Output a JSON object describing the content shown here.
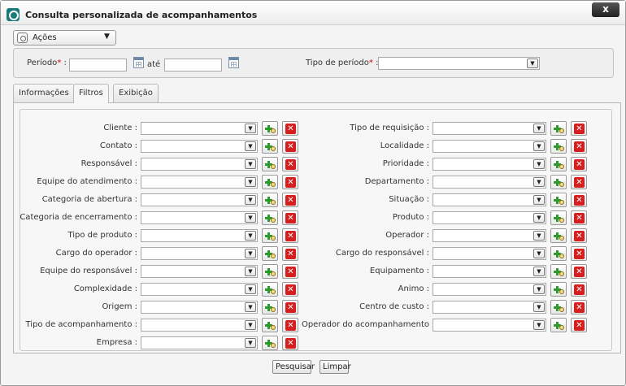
{
  "window": {
    "title": "Consulta personalizada de acompanhamentos",
    "close_label": "x"
  },
  "actions_menu": {
    "label": "Ações",
    "arrow": "▼"
  },
  "period": {
    "label": "Período",
    "required_mark": "*",
    "colon": ":",
    "start_value": "",
    "between_label": "até",
    "end_value": "",
    "type_label": "Tipo de período",
    "type_value": ""
  },
  "tabs": [
    {
      "label": "Informações"
    },
    {
      "label": "Filtros"
    },
    {
      "label": "Exibição"
    }
  ],
  "active_tab": "Filtros",
  "filters": {
    "left": [
      {
        "label": "Cliente :",
        "value": ""
      },
      {
        "label": "Contato :",
        "value": ""
      },
      {
        "label": "Responsável :",
        "value": ""
      },
      {
        "label": "Equipe do atendimento :",
        "value": ""
      },
      {
        "label": "Categoria de abertura :",
        "value": ""
      },
      {
        "label": "Categoria de encerramento :",
        "value": ""
      },
      {
        "label": "Tipo de produto :",
        "value": ""
      },
      {
        "label": "Cargo do operador :",
        "value": ""
      },
      {
        "label": "Equipe do responsável :",
        "value": ""
      },
      {
        "label": "Complexidade :",
        "value": ""
      },
      {
        "label": "Origem :",
        "value": ""
      },
      {
        "label": "Tipo de acompanhamento :",
        "value": ""
      },
      {
        "label": "Empresa :",
        "value": ""
      }
    ],
    "right": [
      {
        "label": "Tipo de requisição :",
        "value": ""
      },
      {
        "label": "Localidade :",
        "value": ""
      },
      {
        "label": "Prioridade :",
        "value": ""
      },
      {
        "label": "Departamento :",
        "value": ""
      },
      {
        "label": "Situação :",
        "value": ""
      },
      {
        "label": "Produto :",
        "value": ""
      },
      {
        "label": "Operador :",
        "value": ""
      },
      {
        "label": "Cargo do responsável :",
        "value": ""
      },
      {
        "label": "Equipamento :",
        "value": ""
      },
      {
        "label": "Animo :",
        "value": ""
      },
      {
        "label": "Centro de custo :",
        "value": ""
      },
      {
        "label": "Operador do acompanhamento",
        "value": ""
      }
    ],
    "add_icon": "add-search-icon",
    "remove_icon": "remove-x-icon",
    "remove_glyph": "✕",
    "dropdown_glyph": "▼"
  },
  "buttons": {
    "search_label": "Pesquisar",
    "clear_label": "Limpar"
  },
  "colors": {
    "accent": "#1a7a7a",
    "required": "#d40000",
    "add": "#2e9a2e",
    "remove": "#d61e1e"
  }
}
